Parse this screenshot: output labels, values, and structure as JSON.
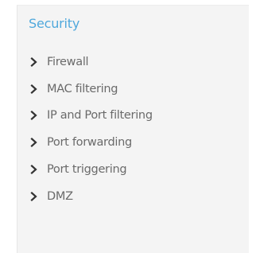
{
  "sidebar": {
    "section_title": "Security",
    "items": [
      {
        "label": "Firewall",
        "icon": "chevron-right-icon"
      },
      {
        "label": "MAC filtering",
        "icon": "chevron-right-icon"
      },
      {
        "label": "IP and Port filtering",
        "icon": "chevron-right-icon"
      },
      {
        "label": "Port forwarding",
        "icon": "chevron-right-icon"
      },
      {
        "label": "Port triggering",
        "icon": "chevron-right-icon"
      },
      {
        "label": "DMZ",
        "icon": "chevron-right-icon"
      }
    ]
  },
  "colors": {
    "accent": "#4fa8dc",
    "text": "#6a6a6a",
    "panel_bg": "#f4f4f4"
  }
}
